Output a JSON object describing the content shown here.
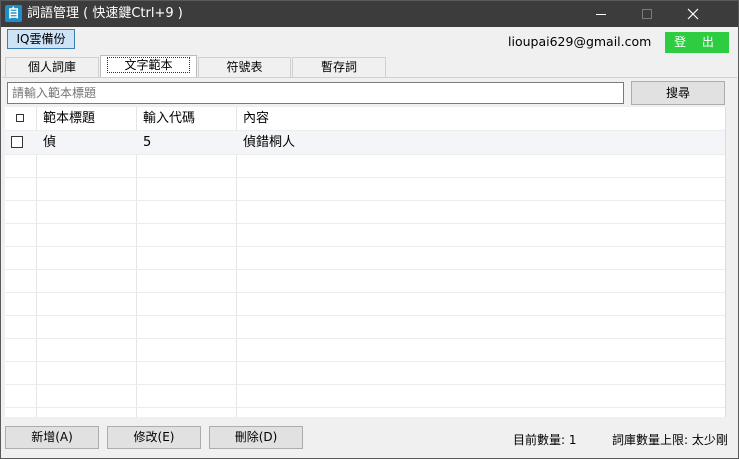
{
  "window": {
    "title": "詞語管理 ( 快速鍵Ctrl+9 )",
    "app_icon_glyph": "自"
  },
  "top": {
    "backup_label": "IQ雲備份",
    "email": "lioupai629@gmail.com",
    "logout_label": "登 出"
  },
  "tabs": [
    {
      "label": "個人詞庫"
    },
    {
      "label": "文字範本"
    },
    {
      "label": "符號表"
    },
    {
      "label": "暫存詞"
    }
  ],
  "search": {
    "placeholder": "請輸入範本標題",
    "button_label": "搜尋"
  },
  "table": {
    "columns": [
      "□",
      "範本標題",
      "輸入代碼",
      "內容"
    ],
    "rows": [
      {
        "title": "偵",
        "code": "5",
        "content": "偵錯桐人"
      }
    ]
  },
  "footer": {
    "add_label": "新增(A)",
    "edit_label": "修改(E)",
    "delete_label": "刪除(D)",
    "count_text": "目前數量: 1",
    "limit_text": "詞庫數量上限: 太少剛"
  },
  "colors": {
    "titlebar": "#3c3c3c",
    "logout": "#2ecc40",
    "backup": "#cde4f7",
    "row_highlight": "#f3f5f8"
  }
}
